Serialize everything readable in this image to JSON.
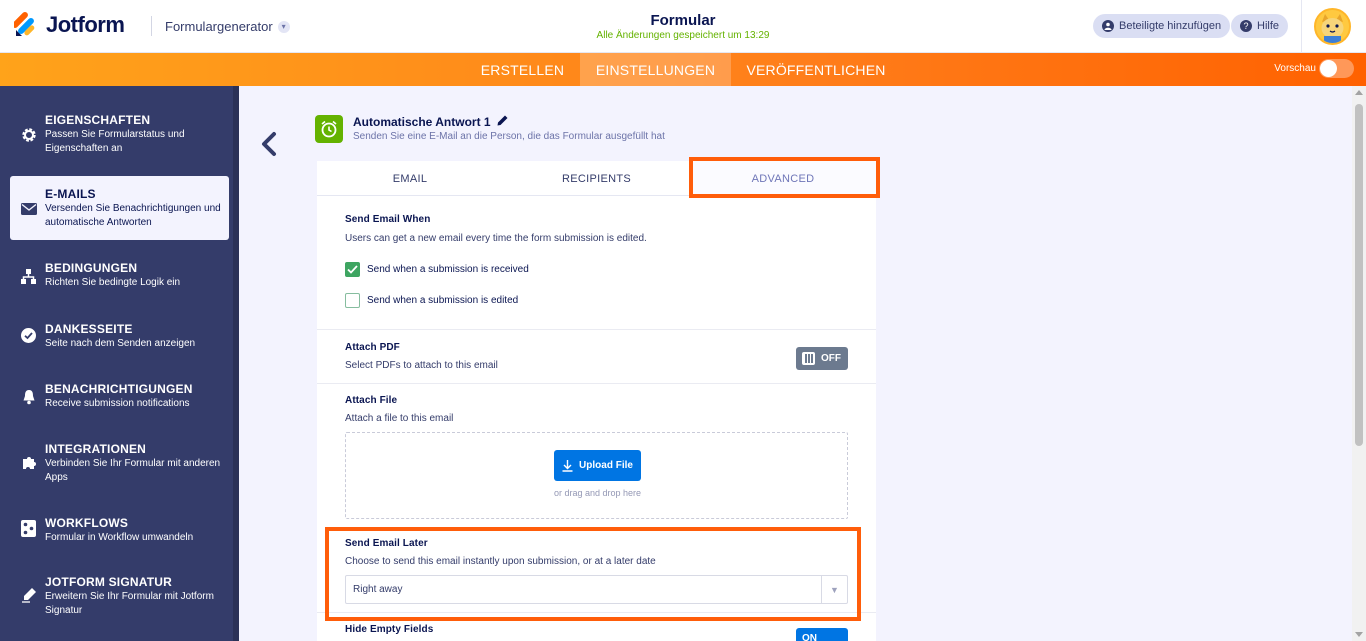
{
  "header": {
    "brand": "Jotform",
    "generator_label": "Formulargenerator",
    "form_title": "Formular",
    "saved_status": "Alle Änderungen gespeichert um 13:29",
    "invite_label": "Beteiligte hinzufügen",
    "help_label": "Hilfe",
    "icons": [
      "jotform-logo-icon",
      "chevron-down-icon",
      "user-icon",
      "help-icon",
      "avatar"
    ]
  },
  "nav": {
    "tabs": [
      {
        "label": "ERSTELLEN",
        "active": false
      },
      {
        "label": "EINSTELLUNGEN",
        "active": true
      },
      {
        "label": "VERÖFFENTLICHEN",
        "active": false
      }
    ],
    "preview_label": "Vorschau",
    "preview_on": false
  },
  "sidebar": {
    "items": [
      {
        "title": "EIGENSCHAFTEN",
        "desc": "Passen Sie Formularstatus und Eigenschaften an",
        "icon": "gear-icon",
        "active": false
      },
      {
        "title": "E-MAILS",
        "desc": "Versenden Sie Benachrichtigungen und automatische Antworten",
        "icon": "envelope-icon",
        "active": true
      },
      {
        "title": "BEDINGUNGEN",
        "desc": "Richten Sie bedingte Logik ein",
        "icon": "sitemap-icon",
        "active": false
      },
      {
        "title": "DANKESSEITE",
        "desc": "Seite nach dem Senden anzeigen",
        "icon": "check-circle-icon",
        "active": false
      },
      {
        "title": "BENACHRICHTIGUNGEN",
        "desc": "Receive submission notifications",
        "icon": "bell-icon",
        "active": false
      },
      {
        "title": "INTEGRATIONEN",
        "desc": "Verbinden Sie Ihr Formular mit anderen Apps",
        "icon": "puzzle-icon",
        "active": false
      },
      {
        "title": "WORKFLOWS",
        "desc": "Formular in Workflow umwandeln",
        "icon": "workflow-icon",
        "active": false
      },
      {
        "title": "JOTFORM SIGNATUR",
        "desc": "Erweitern Sie Ihr Formular mit Jotform Signatur",
        "icon": "pen-icon",
        "active": false
      }
    ]
  },
  "email": {
    "name": "Automatische Antwort 1",
    "description": "Senden Sie eine E-Mail an die Person, die das Formular ausgefüllt hat",
    "tabs": [
      {
        "label": "EMAIL",
        "selected": false
      },
      {
        "label": "RECIPIENTS",
        "selected": false
      },
      {
        "label": "ADVANCED",
        "selected": true
      }
    ]
  },
  "advanced": {
    "send_when": {
      "title": "Send Email When",
      "desc": "Users can get a new email every time the form submission is edited.",
      "opt_received": "Send when a submission is received",
      "opt_received_checked": true,
      "opt_edited": "Send when a submission is edited",
      "opt_edited_checked": false
    },
    "attach_pdf": {
      "title": "Attach PDF",
      "desc": "Select PDFs to attach to this email",
      "state": "OFF"
    },
    "attach_file": {
      "title": "Attach File",
      "desc": "Attach a file to this email",
      "upload_label": "Upload File",
      "drag_text": "or drag and drop here"
    },
    "send_later": {
      "title": "Send Email Later",
      "desc": "Choose to send this email instantly upon submission, or at a later date",
      "value": "Right away"
    },
    "hide_empty": {
      "title": "Hide Empty Fields",
      "state": "ON"
    }
  },
  "colors": {
    "brand_navy": "#0a1551",
    "sidebar": "#343c6a",
    "orange": "#ff6100",
    "highlight": "#ff5d0a",
    "green": "#64b200",
    "upload_blue": "#0075e3"
  }
}
